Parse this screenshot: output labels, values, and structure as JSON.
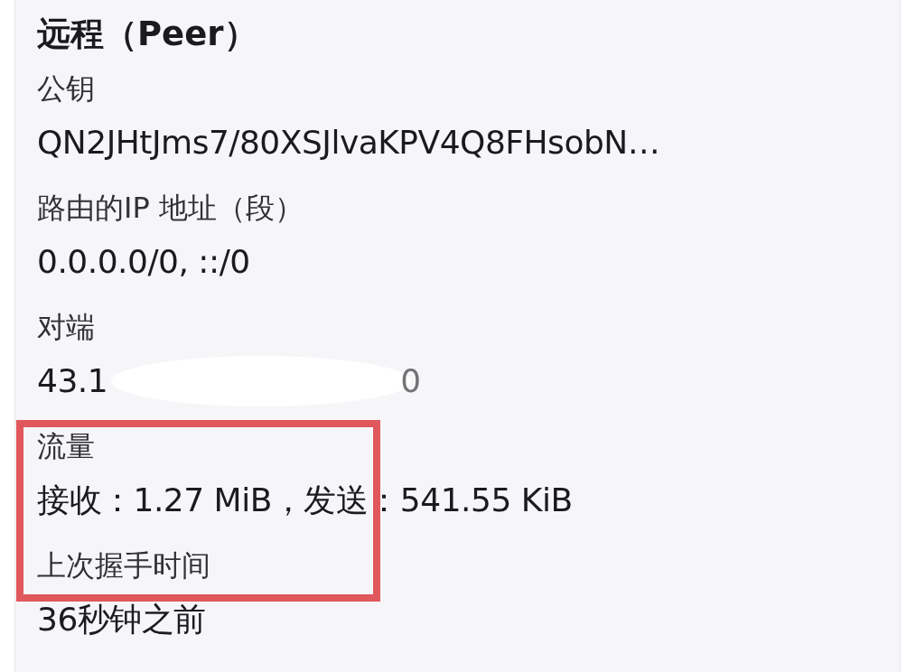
{
  "title": "远程（Peer）",
  "fields": [
    {
      "label": "公钥",
      "value": "QN2JHtJms7/80XSJlvaKPV4Q8FHsobN…"
    },
    {
      "label": "路由的IP 地址（段）",
      "value": "0.0.0.0/0, ::/0"
    },
    {
      "label": "对端",
      "value": "43.1",
      "redacted": true,
      "value_tail": "0"
    },
    {
      "label": "流量",
      "value": "接收：1.27 MiB，发送：541.55 KiB"
    },
    {
      "label": "上次握手时间",
      "value": "36秒钟之前"
    }
  ],
  "highlight": {
    "color": "#e0575c"
  }
}
